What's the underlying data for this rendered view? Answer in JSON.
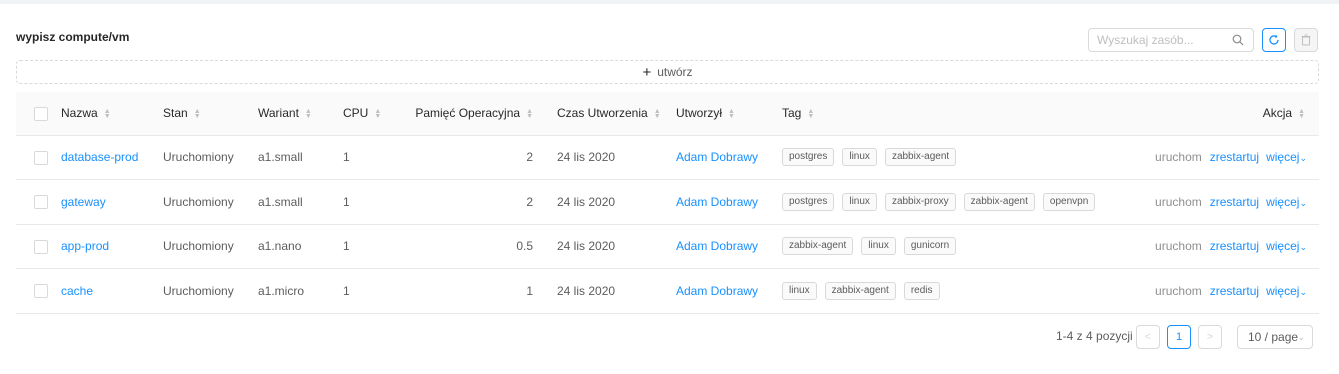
{
  "header": {
    "title": "wypisz compute/vm",
    "search_placeholder": "Wyszukaj zasób...",
    "icons": {
      "search": "search-icon",
      "refresh": "reload-icon",
      "delete": "trash-icon"
    }
  },
  "create": {
    "label": "utwórz",
    "icon": "plus-icon"
  },
  "table": {
    "columns": [
      "Nazwa",
      "Stan",
      "Wariant",
      "CPU",
      "Pamięć Operacyjna",
      "Czas Utworzenia",
      "Utworzył",
      "Tag",
      "Akcja"
    ],
    "rows": [
      {
        "name": "database-prod",
        "state": "Uruchomiony",
        "variant": "a1.small",
        "cpu": "1",
        "memory": "2",
        "created": "24 lis 2020",
        "author": "Adam Dobrawy",
        "tags": [
          "postgres",
          "linux",
          "zabbix-agent"
        ]
      },
      {
        "name": "gateway",
        "state": "Uruchomiony",
        "variant": "a1.small",
        "cpu": "1",
        "memory": "2",
        "created": "24 lis 2020",
        "author": "Adam Dobrawy",
        "tags": [
          "postgres",
          "linux",
          "zabbix-proxy",
          "zabbix-agent",
          "openvpn"
        ]
      },
      {
        "name": "app-prod",
        "state": "Uruchomiony",
        "variant": "a1.nano",
        "cpu": "1",
        "memory": "0.5",
        "created": "24 lis 2020",
        "author": "Adam Dobrawy",
        "tags": [
          "zabbix-agent",
          "linux",
          "gunicorn"
        ]
      },
      {
        "name": "cache",
        "state": "Uruchomiony",
        "variant": "a1.micro",
        "cpu": "1",
        "memory": "1",
        "created": "24 lis 2020",
        "author": "Adam Dobrawy",
        "tags": [
          "linux",
          "zabbix-agent",
          "redis"
        ]
      }
    ],
    "actions": {
      "start": "uruchom",
      "restart": "zrestartuj",
      "more": "więcej"
    }
  },
  "pagination": {
    "total": "1-4 z 4 pozycji",
    "prev": "<",
    "current": "1",
    "next": ">",
    "page_size": "10 / page"
  },
  "colors": {
    "accent": "#1890ff",
    "border": "#e8e8e8",
    "header_bg": "#fafafa"
  }
}
